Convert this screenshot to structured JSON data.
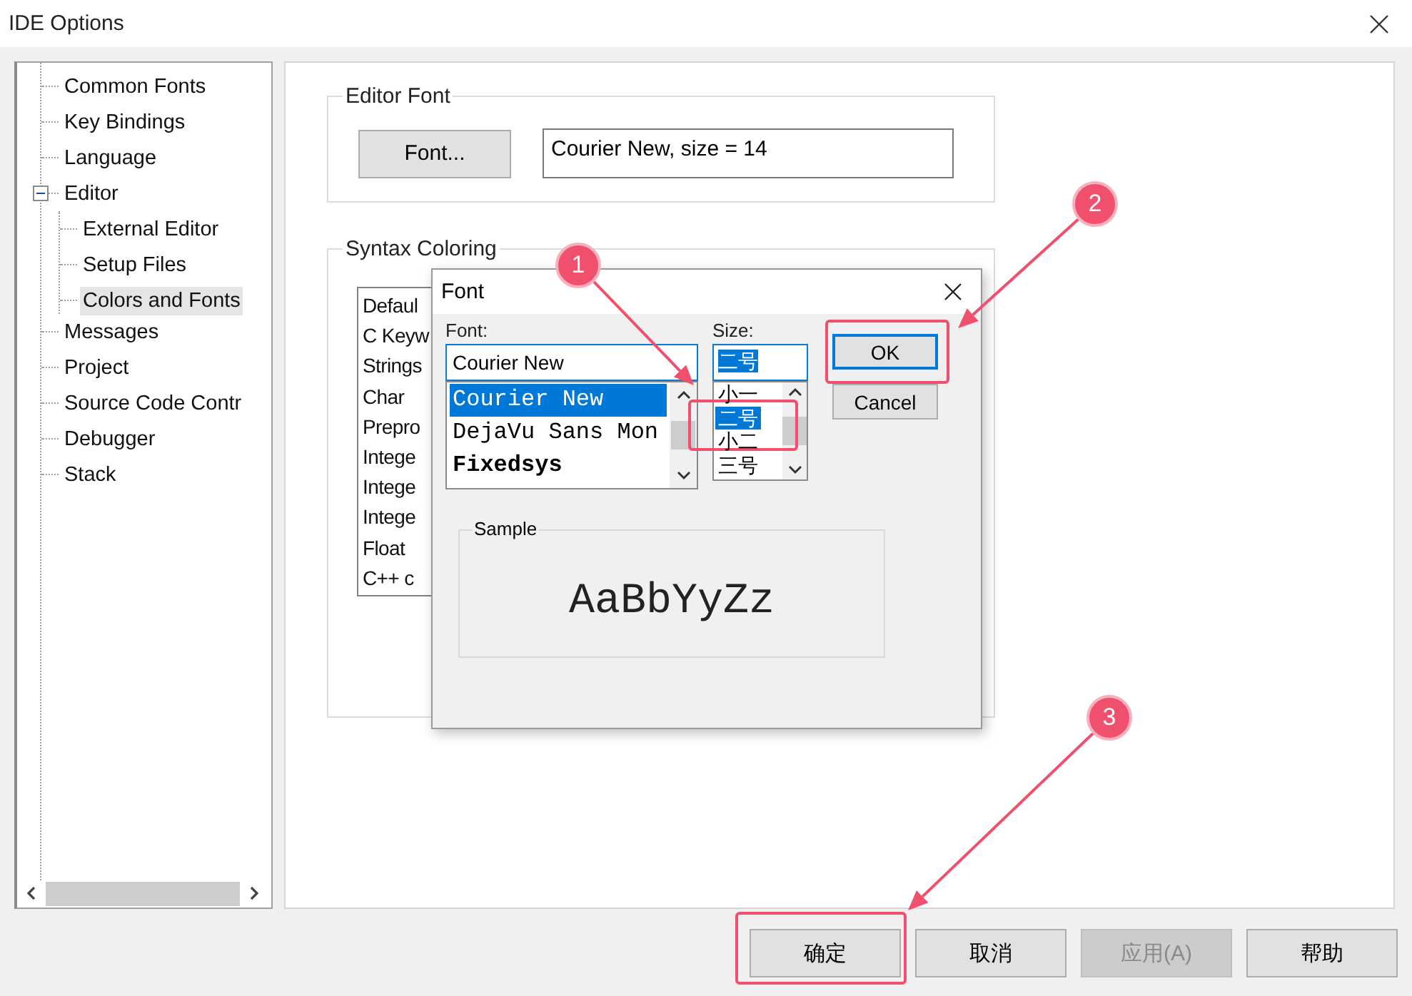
{
  "window": {
    "title": "IDE Options"
  },
  "tree": [
    {
      "label": "Common Fonts",
      "selected": false
    },
    {
      "label": "Key Bindings",
      "selected": false
    },
    {
      "label": "Language",
      "selected": false
    },
    {
      "label": "Editor",
      "selected": false,
      "expanded": true,
      "children": [
        {
          "label": "External Editor",
          "selected": false
        },
        {
          "label": "Setup Files",
          "selected": false
        },
        {
          "label": "Colors and Fonts",
          "selected": true
        }
      ]
    },
    {
      "label": "Messages",
      "selected": false
    },
    {
      "label": "Project",
      "selected": false
    },
    {
      "label": "Source Code Contr",
      "selected": false
    },
    {
      "label": "Debugger",
      "selected": false
    },
    {
      "label": "Stack",
      "selected": false
    }
  ],
  "editor_font": {
    "title": "Editor Font",
    "button": "Font...",
    "value": "Courier New, size = 14"
  },
  "syntax_coloring": {
    "title": "Syntax Coloring",
    "items": [
      "Defaul",
      "C Keyw",
      "Strings",
      "Char",
      "Prepro",
      "Intege",
      "Intege",
      "Intege",
      "Float",
      "C++ c"
    ]
  },
  "font_dialog": {
    "title": "Font",
    "font_label": "Font:",
    "font_value": "Courier New",
    "fonts": [
      {
        "label": "Courier New",
        "selected": true,
        "bold": false
      },
      {
        "label": "DejaVu Sans Mon",
        "selected": false,
        "bold": false
      },
      {
        "label": "Fixedsys",
        "selected": false,
        "bold": true
      }
    ],
    "size_label": "Size:",
    "size_value": "二号",
    "sizes": [
      {
        "label": "小一",
        "selected": false,
        "highlighted": false
      },
      {
        "label": "二号",
        "selected": true,
        "highlighted": true
      },
      {
        "label": "小二",
        "selected": false,
        "highlighted": false
      },
      {
        "label": "三号",
        "selected": false,
        "highlighted": false
      }
    ],
    "buttons": [
      {
        "label": "OK",
        "default": true,
        "highlighted": true
      },
      {
        "label": "Cancel",
        "default": false,
        "highlighted": false
      }
    ],
    "sample_title": "Sample",
    "sample_text": "AaBbYyZz"
  },
  "buttons": [
    {
      "label": "确定",
      "disabled": false,
      "highlighted": true
    },
    {
      "label": "取消",
      "disabled": false,
      "highlighted": false
    },
    {
      "label": "应用(A)",
      "disabled": true,
      "highlighted": false
    },
    {
      "label": "帮助",
      "disabled": false,
      "highlighted": false
    }
  ],
  "annotations": [
    {
      "label": "1"
    },
    {
      "label": "2"
    },
    {
      "label": "3"
    }
  ]
}
